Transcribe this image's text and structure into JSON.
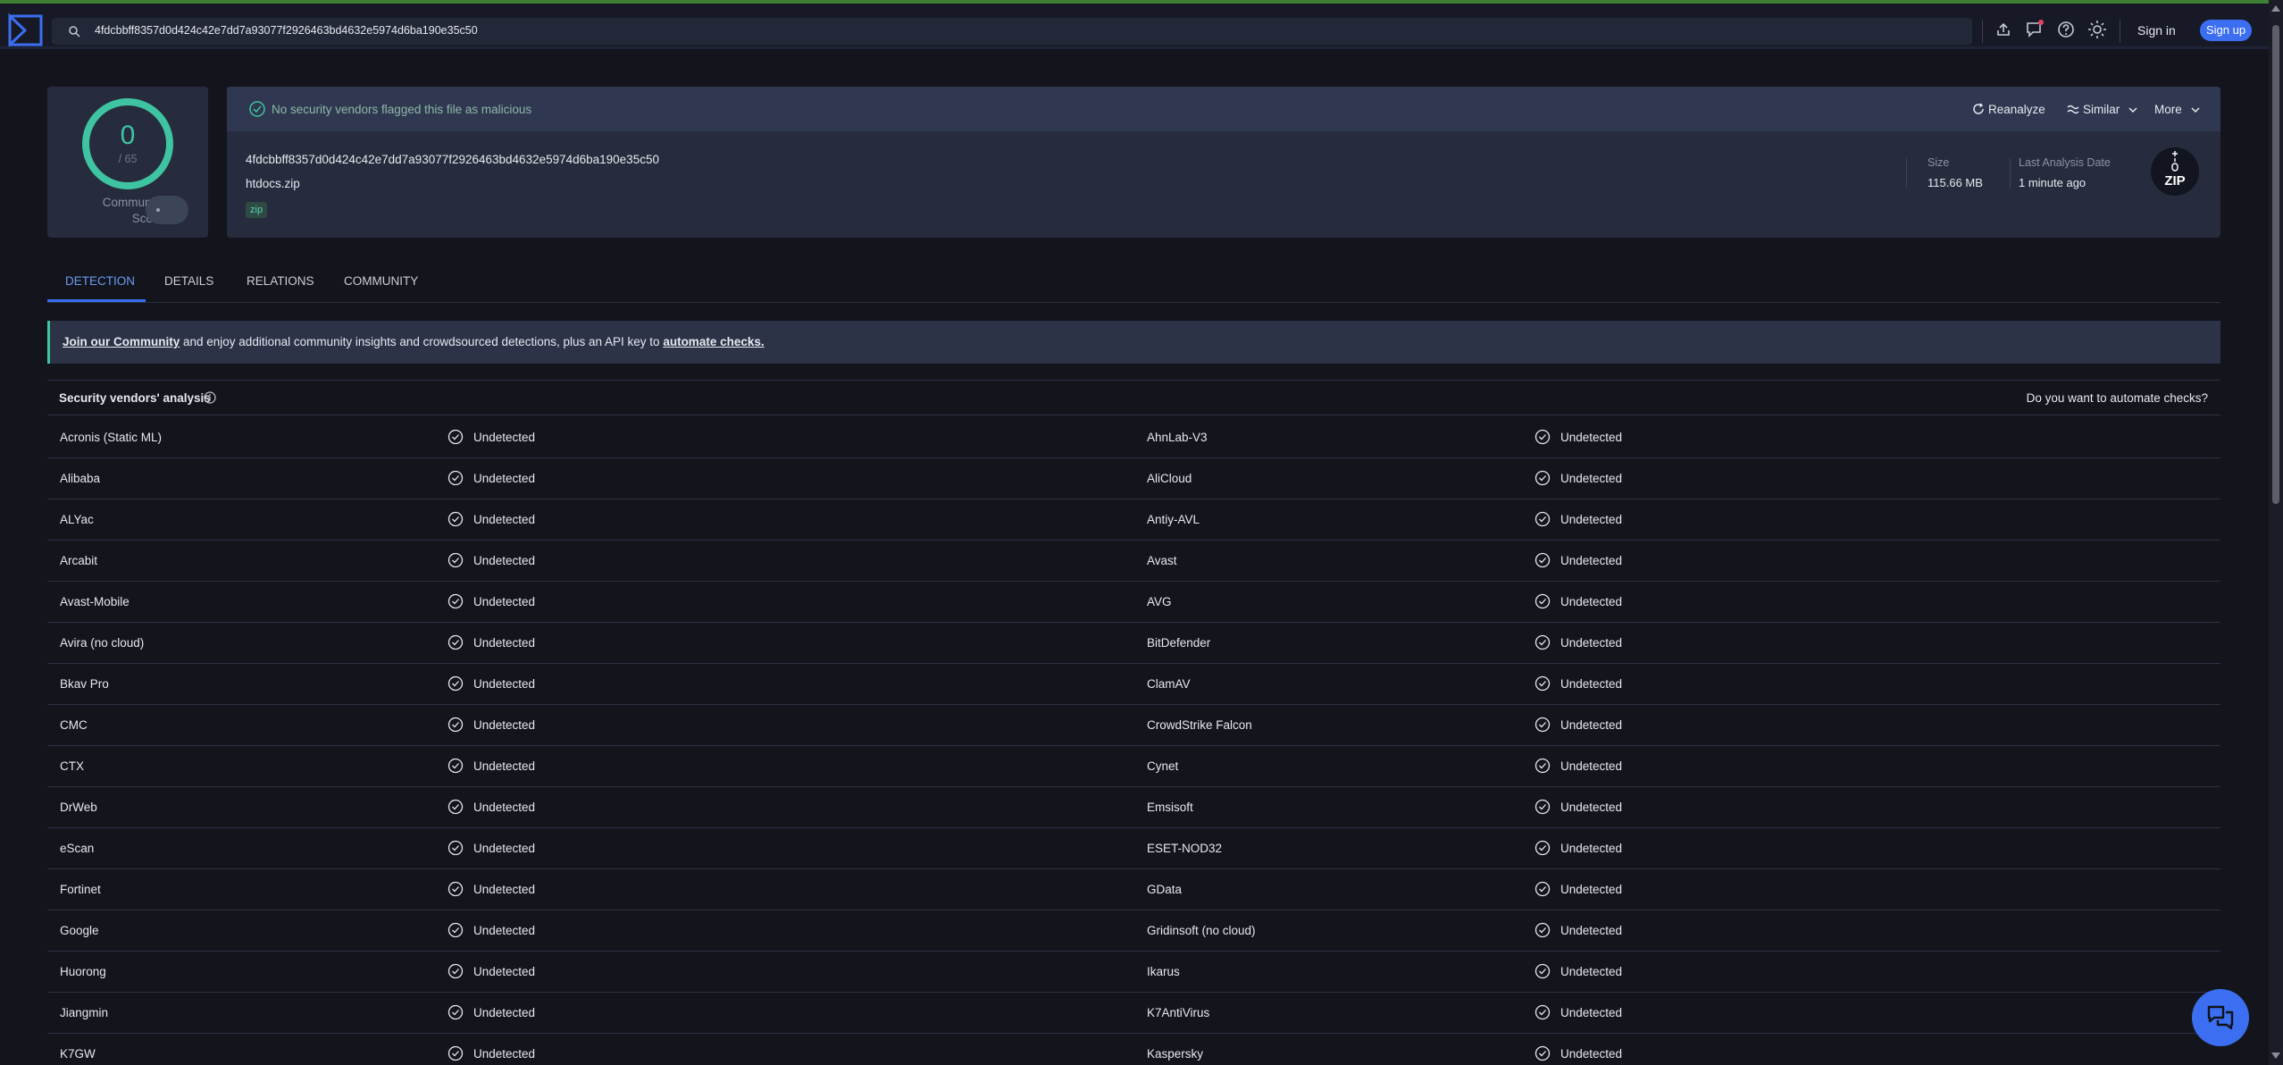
{
  "header": {
    "search_value": "4fdcbbff8357d0d424c42e7dd7a93077f2926463bd4632e5974d6ba190e35c50",
    "icons": [
      "upload-icon",
      "notifications-icon",
      "help-icon",
      "theme-icon"
    ],
    "signin_label": "Sign in",
    "signup_label": "Sign up"
  },
  "score": {
    "detections": "0",
    "total": "/ 65",
    "community_label": "Community Score"
  },
  "summary": {
    "status_text": "No security vendors flagged this file as malicious",
    "actions": {
      "reanalyze": "Reanalyze",
      "similar": "Similar",
      "more": "More"
    },
    "hash": "4fdcbbff8357d0d424c42e7dd7a93077f2926463bd4632e5974d6ba190e35c50",
    "filename": "htdocs.zip",
    "tag": "zip",
    "size_label": "Size",
    "size_value": "115.66 MB",
    "date_label": "Last Analysis Date",
    "date_value": "1 minute ago",
    "filetype_icon": "ZIP"
  },
  "tabs": [
    "DETECTION",
    "DETAILS",
    "RELATIONS",
    "COMMUNITY"
  ],
  "active_tab": "DETECTION",
  "banner": {
    "join_link": "Join our Community",
    "middle_text": " and enjoy additional community insights and crowdsourced detections, plus an API key to ",
    "automate_link": "automate checks."
  },
  "analysis": {
    "title": "Security vendors' analysis",
    "automate_question": "Do you want to automate checks?"
  },
  "vendors": [
    [
      "Acronis (Static ML)",
      "Undetected",
      "AhnLab-V3",
      "Undetected"
    ],
    [
      "Alibaba",
      "Undetected",
      "AliCloud",
      "Undetected"
    ],
    [
      "ALYac",
      "Undetected",
      "Antiy-AVL",
      "Undetected"
    ],
    [
      "Arcabit",
      "Undetected",
      "Avast",
      "Undetected"
    ],
    [
      "Avast-Mobile",
      "Undetected",
      "AVG",
      "Undetected"
    ],
    [
      "Avira (no cloud)",
      "Undetected",
      "BitDefender",
      "Undetected"
    ],
    [
      "Bkav Pro",
      "Undetected",
      "ClamAV",
      "Undetected"
    ],
    [
      "CMC",
      "Undetected",
      "CrowdStrike Falcon",
      "Undetected"
    ],
    [
      "CTX",
      "Undetected",
      "Cynet",
      "Undetected"
    ],
    [
      "DrWeb",
      "Undetected",
      "Emsisoft",
      "Undetected"
    ],
    [
      "eScan",
      "Undetected",
      "ESET-NOD32",
      "Undetected"
    ],
    [
      "Fortinet",
      "Undetected",
      "GData",
      "Undetected"
    ],
    [
      "Google",
      "Undetected",
      "Gridinsoft (no cloud)",
      "Undetected"
    ],
    [
      "Huorong",
      "Undetected",
      "Ikarus",
      "Undetected"
    ],
    [
      "Jiangmin",
      "Undetected",
      "K7AntiVirus",
      "Undetected"
    ],
    [
      "K7GW",
      "Undetected",
      "Kaspersky",
      "Undetected"
    ]
  ],
  "colors": {
    "accent": "#3b6ef0",
    "ok_green": "#3ec4a1",
    "background": "#13141c",
    "panel": "#262c3d"
  }
}
